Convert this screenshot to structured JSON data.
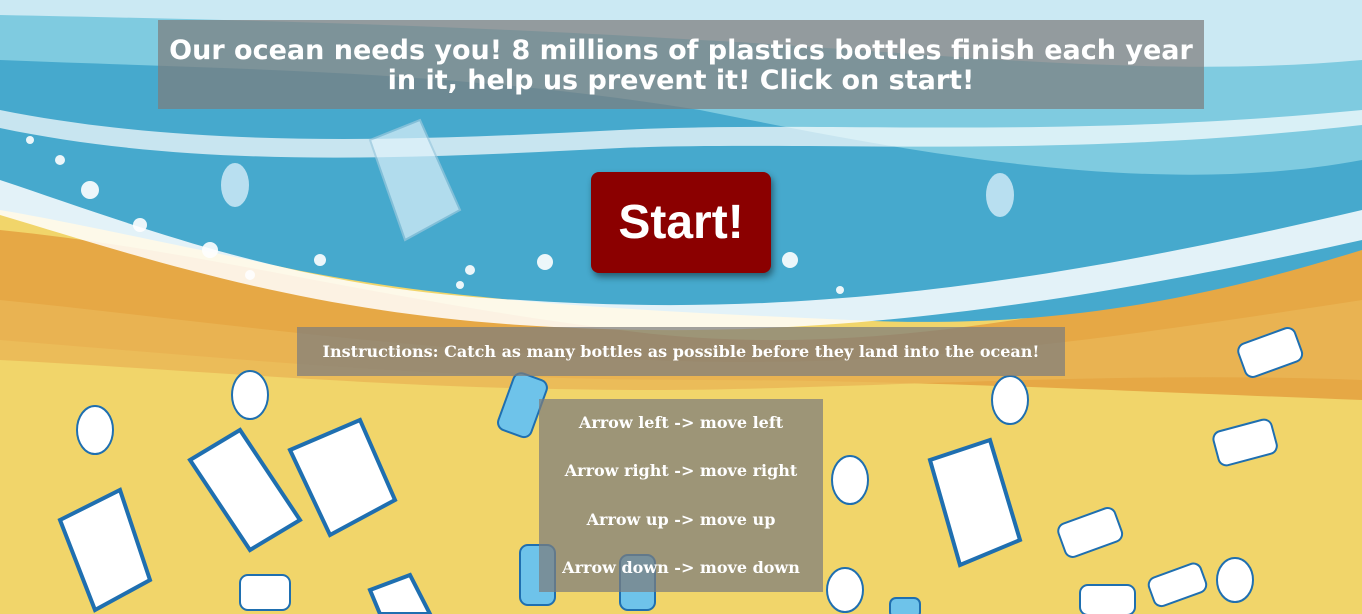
{
  "title": "Our ocean needs you! 8 millions of plastics bottles finish each year in it, help us prevent it! Click on start!",
  "start_button": {
    "label": "Start!"
  },
  "instructions": "Instructions: Catch as many bottles as possible before they land into the ocean!",
  "controls": [
    "Arrow left -> move left",
    "Arrow right -> move right",
    "Arrow up -> move up",
    "Arrow down -> move down"
  ],
  "colors": {
    "ocean_light": "#cbe9f3",
    "ocean_mid": "#7fcbe0",
    "ocean_deep": "#46a9cd",
    "sand_dark": "#e0a13f",
    "sand": "#f1d56a",
    "start_button": "#8b0000",
    "panel": "#7d7d7d"
  }
}
